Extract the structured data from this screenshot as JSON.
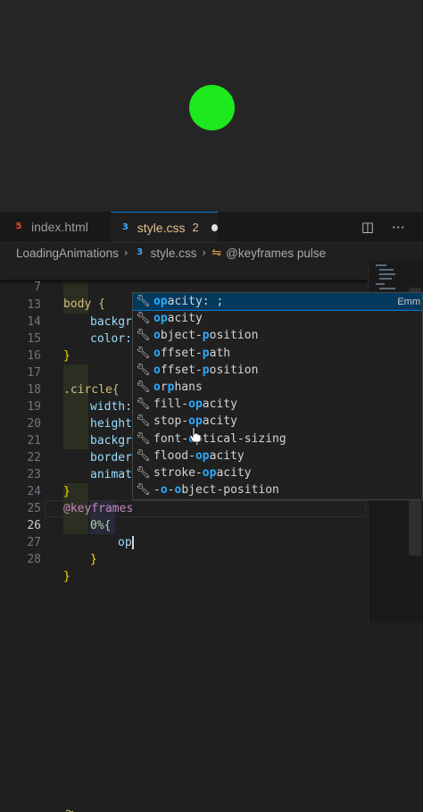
{
  "preview": {
    "circle_color": "#1ee81e",
    "background": "#252525"
  },
  "tabs": [
    {
      "label": "index.html",
      "icon": "html5-icon"
    },
    {
      "label": "style.css",
      "icon": "css3-icon",
      "problems": "2",
      "unsaved": true
    }
  ],
  "breadcrumb": {
    "folder": "LoadingAnimations",
    "file": "style.css",
    "symbol": "@keyframes pulse"
  },
  "editor": {
    "sticky": {
      "ln": "7",
      "text": "body {"
    },
    "lines": [
      {
        "ln": "13",
        "t": "background: "
      },
      {
        "ln": "14",
        "t": "color: "
      },
      {
        "ln": "15",
        "t": "}"
      },
      {
        "ln": "16",
        "t": ""
      },
      {
        "ln": "17",
        "t": ".circle{"
      },
      {
        "ln": "18",
        "t": "width: "
      },
      {
        "ln": "19",
        "t": "height"
      },
      {
        "ln": "20",
        "t": "backgr"
      },
      {
        "ln": "21",
        "t": "border"
      },
      {
        "ln": "22",
        "t": "animat"
      },
      {
        "ln": "23",
        "t": "}"
      },
      {
        "ln": "24",
        "t": "@keyframes"
      },
      {
        "ln": "25",
        "t": "0%{"
      },
      {
        "ln": "26",
        "t": "op"
      },
      {
        "ln": "27",
        "t": "}"
      },
      {
        "ln": "28",
        "t": "}"
      }
    ],
    "color_value": "#252525"
  },
  "suggestions": [
    {
      "pre": "",
      "hl": "op",
      "post": "acity: ;",
      "detail": "Emm"
    },
    {
      "pre": "",
      "hl": "op",
      "post": "acity"
    },
    {
      "pre": "",
      "hl": "o",
      "post": "bject-",
      "hl2": "p",
      "post2": "osition"
    },
    {
      "pre": "",
      "hl": "o",
      "post": "ffset-",
      "hl2": "p",
      "post2": "ath"
    },
    {
      "pre": "",
      "hl": "o",
      "post": "ffset-",
      "hl2": "p",
      "post2": "osition"
    },
    {
      "pre": "",
      "hl": "o",
      "post": "r",
      "hl2": "p",
      "post2": "hans"
    },
    {
      "pre": "fill-",
      "hl": "op",
      "post": "acity"
    },
    {
      "pre": "stop-",
      "hl": "op",
      "post": "acity"
    },
    {
      "pre": "font-",
      "hl": "o",
      "post": "ptical-sizing"
    },
    {
      "pre": "flood-",
      "hl": "op",
      "post": "acity"
    },
    {
      "pre": "stroke-",
      "hl": "op",
      "post": "acity"
    },
    {
      "pre": "-",
      "hl": "o",
      "post": "-",
      "hl2": "o",
      "post2": "bject-position"
    }
  ],
  "colors": {
    "accent": "#0078d4",
    "match": "#2aaaff",
    "selector": "#d7ba7d",
    "property": "#9cdcfe",
    "keyword": "#c586c0"
  }
}
